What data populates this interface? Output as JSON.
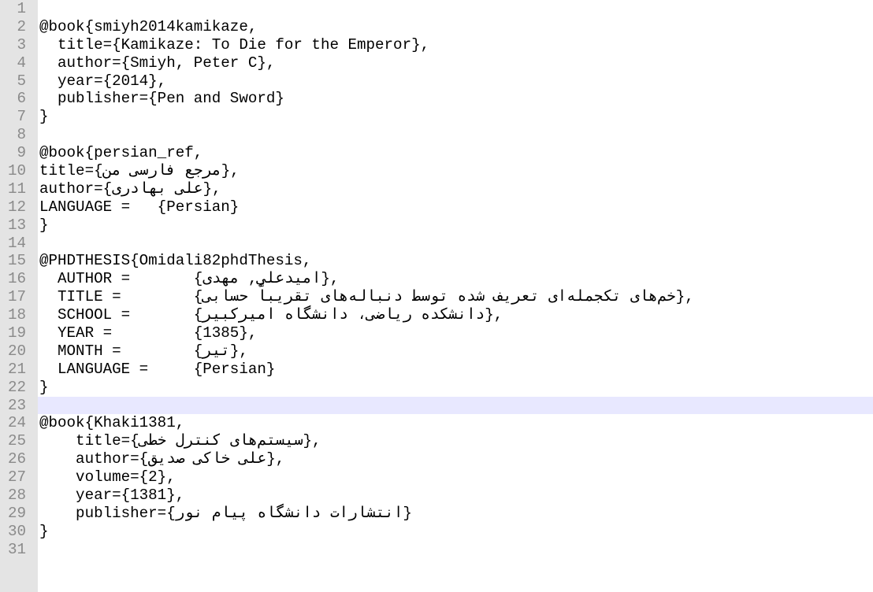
{
  "editor": {
    "current_line": 23,
    "colors": {
      "gutter_bg": "#e4e4e4",
      "line_number": "#8a8a8a",
      "current_line_bg": "#e8e8ff",
      "text": "#000000",
      "background": "#ffffff"
    },
    "lines": [
      {
        "n": "1",
        "text": ""
      },
      {
        "n": "2",
        "text": "@book{smiyh2014kamikaze,"
      },
      {
        "n": "3",
        "text": "  title={Kamikaze: To Die for the Emperor},"
      },
      {
        "n": "4",
        "text": "  author={Smiyh, Peter C},"
      },
      {
        "n": "5",
        "text": "  year={2014},"
      },
      {
        "n": "6",
        "text": "  publisher={Pen and Sword}"
      },
      {
        "n": "7",
        "text": "}"
      },
      {
        "n": "8",
        "text": ""
      },
      {
        "n": "9",
        "text": "@book{persian_ref,"
      },
      {
        "n": "10",
        "text": "title={مرجع فارسی من},"
      },
      {
        "n": "11",
        "text": "author={علی بهادری},"
      },
      {
        "n": "12",
        "text": "LANGUAGE =   {Persian}"
      },
      {
        "n": "13",
        "text": "}"
      },
      {
        "n": "14",
        "text": ""
      },
      {
        "n": "15",
        "text": "@PHDTHESIS{Omidali82phdThesis,"
      },
      {
        "n": "16",
        "text": "  AUTHOR =       {امیدعلي, مهدی},"
      },
      {
        "n": "17",
        "text": "  TITLE =        {خم‌های تکجمله‌ای تعریف شده توسط دنباله‌های تقریباً حسابی},"
      },
      {
        "n": "18",
        "text": "  SCHOOL =       {دانشکده ریاضی، دانشگاه امیرکبیر},"
      },
      {
        "n": "19",
        "text": "  YEAR =         {1385},"
      },
      {
        "n": "20",
        "text": "  MONTH =        {تیر},"
      },
      {
        "n": "21",
        "text": "  LANGUAGE =     {Persian}"
      },
      {
        "n": "22",
        "text": "}"
      },
      {
        "n": "23",
        "text": ""
      },
      {
        "n": "24",
        "text": "@book{Khaki1381,"
      },
      {
        "n": "25",
        "text": "    title={سیستم‌های کنترل خطی},"
      },
      {
        "n": "26",
        "text": "    author={علی خاکی صدیق},"
      },
      {
        "n": "27",
        "text": "    volume={2},"
      },
      {
        "n": "28",
        "text": "    year={1381},"
      },
      {
        "n": "29",
        "text": "    publisher={انتشارات دانشگاه پیام نور}"
      },
      {
        "n": "30",
        "text": "}"
      },
      {
        "n": "31",
        "text": ""
      }
    ]
  }
}
